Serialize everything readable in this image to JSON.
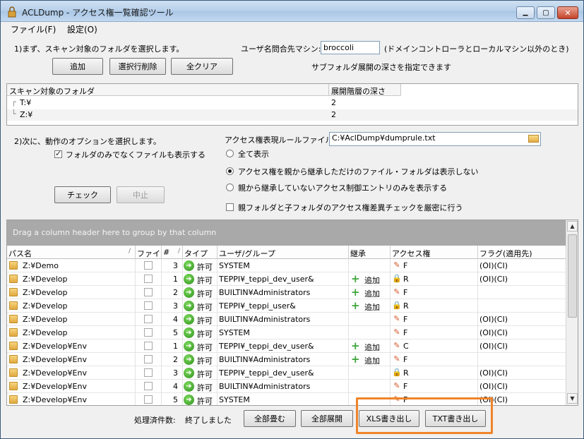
{
  "window": {
    "title": "ACLDump - アクセス権一覧確認ツール",
    "controls": {
      "minimize": "▁",
      "maximize": "▢",
      "close": "✕"
    }
  },
  "menu": {
    "items": [
      {
        "label": "ファイル(F)"
      },
      {
        "label": "設定(O)"
      }
    ]
  },
  "step1": {
    "instruction": "1)まず、スキャン対象のフォルダを選択します。",
    "add_button": "追加",
    "delete_selected_button": "選択行削除",
    "clear_all_button": "全クリア",
    "user_machine_label": "ユーザ名問合先マシン:",
    "user_machine_value": "broccoli",
    "user_machine_note": "(ドメインコントローラとローカルマシン以外のとき)",
    "depth_note": "サブフォルダ展開の深さを指定できます"
  },
  "scan_table": {
    "headers": {
      "folder": "スキャン対象のフォルダ",
      "depth": "展開階層の深さ"
    },
    "rows": [
      {
        "folder": "T:¥",
        "depth": "2"
      },
      {
        "folder": "Z:¥",
        "depth": "2"
      }
    ]
  },
  "step2": {
    "instruction": "2)次に、動作のオプションを選択します。",
    "show_files_label": "フォルダのみでなくファイルも表示する",
    "show_files_checked": true,
    "rule_file_label": "アクセス権表現ルールファイル:",
    "rule_file_value": "C:¥AclDump¥dumprule.txt",
    "radio_all": "全て表示",
    "radio_hide_inherited": "アクセス権を親から継承しただけのファイル・フォルダは表示しない",
    "radio_only_noninherited": "親から継承していないアクセス制御エントリのみを表示する",
    "radio_selected": 1,
    "strict_check_label": "親フォルダと子フォルダのアクセス権差異チェックを厳密に行う",
    "strict_check_checked": false,
    "check_button": "チェック",
    "stop_button": "中止"
  },
  "grid": {
    "group_hint": "Drag a column header here to group by that column",
    "columns": {
      "path": "パス名",
      "file": "ファイル",
      "num": "#",
      "type": "タイプ",
      "user": "ユーザ/グループ",
      "inherit": "継承",
      "access": "アクセス権",
      "flag": "フラグ(適用先)"
    },
    "rows": [
      {
        "path": "Z:¥Demo",
        "num": "3",
        "type": "許可",
        "user": "SYSTEM",
        "inherit": "",
        "access": "F",
        "flag": "(OI)(CI)"
      },
      {
        "path": "Z:¥Develop",
        "num": "1",
        "type": "許可",
        "user": "TEPPI¥_teppi_dev_user&",
        "inherit": "追加",
        "access": "R",
        "flag": "(OI)(CI)"
      },
      {
        "path": "Z:¥Develop",
        "num": "2",
        "type": "許可",
        "user": "BUILTIN¥Administrators",
        "inherit": "追加",
        "access": "F",
        "flag": ""
      },
      {
        "path": "Z:¥Develop",
        "num": "3",
        "type": "許可",
        "user": "TEPPI¥_teppi_user&",
        "inherit": "追加",
        "access": "R",
        "flag": ""
      },
      {
        "path": "Z:¥Develop",
        "num": "4",
        "type": "許可",
        "user": "BUILTIN¥Administrators",
        "inherit": "",
        "access": "F",
        "flag": "(OI)(CI)"
      },
      {
        "path": "Z:¥Develop",
        "num": "5",
        "type": "許可",
        "user": "SYSTEM",
        "inherit": "",
        "access": "F",
        "flag": "(OI)(CI)"
      },
      {
        "path": "Z:¥Develop¥Env",
        "num": "1",
        "type": "許可",
        "user": "TEPPI¥_teppi_dev_user&",
        "inherit": "追加",
        "access": "C",
        "flag": "(OI)(CI)"
      },
      {
        "path": "Z:¥Develop¥Env",
        "num": "2",
        "type": "許可",
        "user": "BUILTIN¥Administrators",
        "inherit": "追加",
        "access": "F",
        "flag": ""
      },
      {
        "path": "Z:¥Develop¥Env",
        "num": "3",
        "type": "許可",
        "user": "TEPPI¥_teppi_dev_user&",
        "inherit": "",
        "access": "R",
        "flag": "(OI)(CI)"
      },
      {
        "path": "Z:¥Develop¥Env",
        "num": "4",
        "type": "許可",
        "user": "BUILTIN¥Administrators",
        "inherit": "",
        "access": "F",
        "flag": "(OI)(CI)"
      },
      {
        "path": "Z:¥Develop¥Env",
        "num": "5",
        "type": "許可",
        "user": "SYSTEM",
        "inherit": "",
        "access": "F",
        "flag": "(OI)(CI)"
      }
    ]
  },
  "footer": {
    "processed_label": "処理済件数:",
    "processed_value": "終了しました",
    "collapse_all_button": "全部畳む",
    "expand_all_button": "全部展開",
    "xls_export_button": "XLS書き出し",
    "txt_export_button": "TXT書き出し"
  },
  "colors": {
    "highlight": "#f0842a",
    "group_panel": "#a9a9a9",
    "allow_icon": "#2e8f1c"
  },
  "icons": {
    "app": "lock-app-icon",
    "folder": "folder-icon",
    "allow": "allow-arrow-icon",
    "add": "plus-icon",
    "access_full": "pen-icon",
    "access_read": "lock-icon"
  }
}
